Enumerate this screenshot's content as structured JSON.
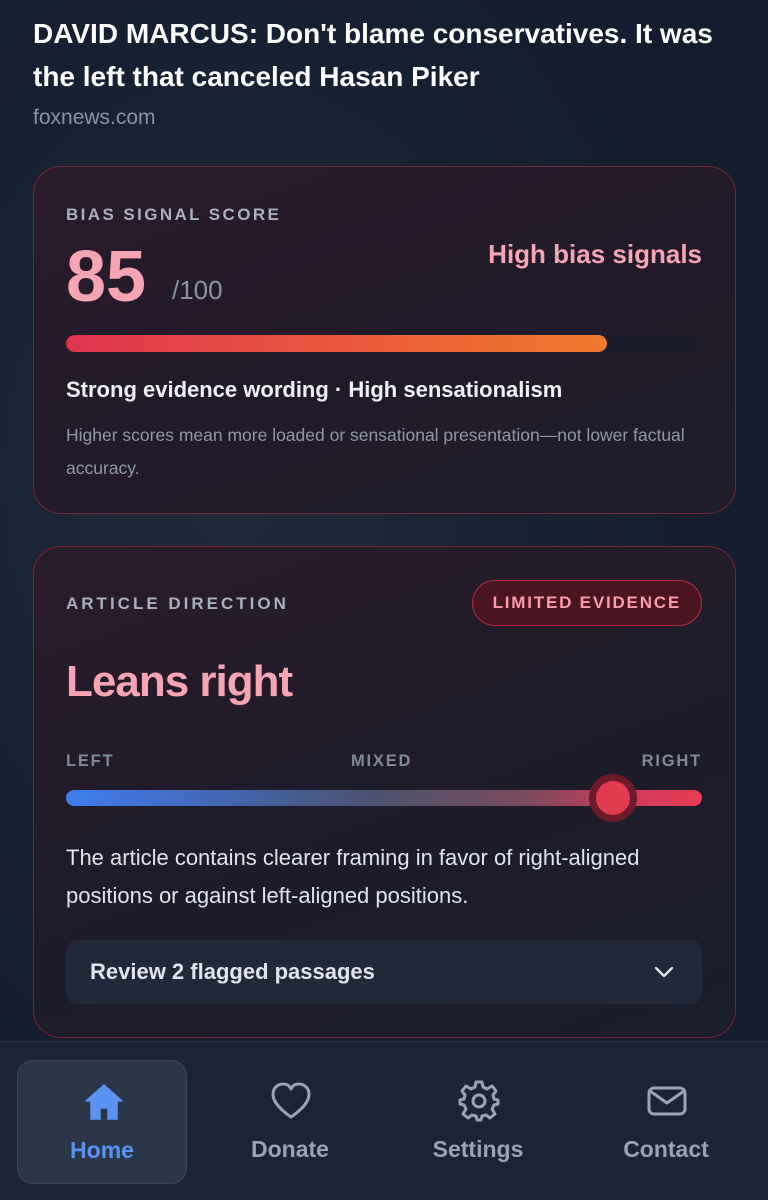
{
  "article": {
    "headline": "DAVID MARCUS: Don't blame conservatives. It was the left that canceled Hasan Piker",
    "source": "foxnews.com"
  },
  "bias_card": {
    "label": "BIAS SIGNAL SCORE",
    "score": "85",
    "score_max": "/100",
    "score_fraction": 0.85,
    "level": "High bias signals",
    "summary": "Strong evidence wording · High sensationalism",
    "note": "Higher scores mean more loaded or sensational presentation—not lower factual accuracy."
  },
  "direction_card": {
    "label": "ARTICLE DIRECTION",
    "badge": "LIMITED EVIDENCE",
    "direction": "Leans right",
    "scale": {
      "left": "LEFT",
      "mixed": "MIXED",
      "right": "RIGHT",
      "position": 0.86
    },
    "explanation": "The article contains clearer framing in favor of right-aligned positions or against left-aligned positions.",
    "review_label": "Review 2 flagged passages"
  },
  "nav": {
    "items": [
      {
        "label": "Home",
        "icon": "home-icon",
        "active": true
      },
      {
        "label": "Donate",
        "icon": "heart-icon",
        "active": false
      },
      {
        "label": "Settings",
        "icon": "gear-icon",
        "active": false
      },
      {
        "label": "Contact",
        "icon": "mail-icon",
        "active": false
      }
    ]
  },
  "colors": {
    "accent_pink": "#f5a5b3",
    "active_blue": "#5b93f2",
    "card_border": "#7a2438"
  }
}
